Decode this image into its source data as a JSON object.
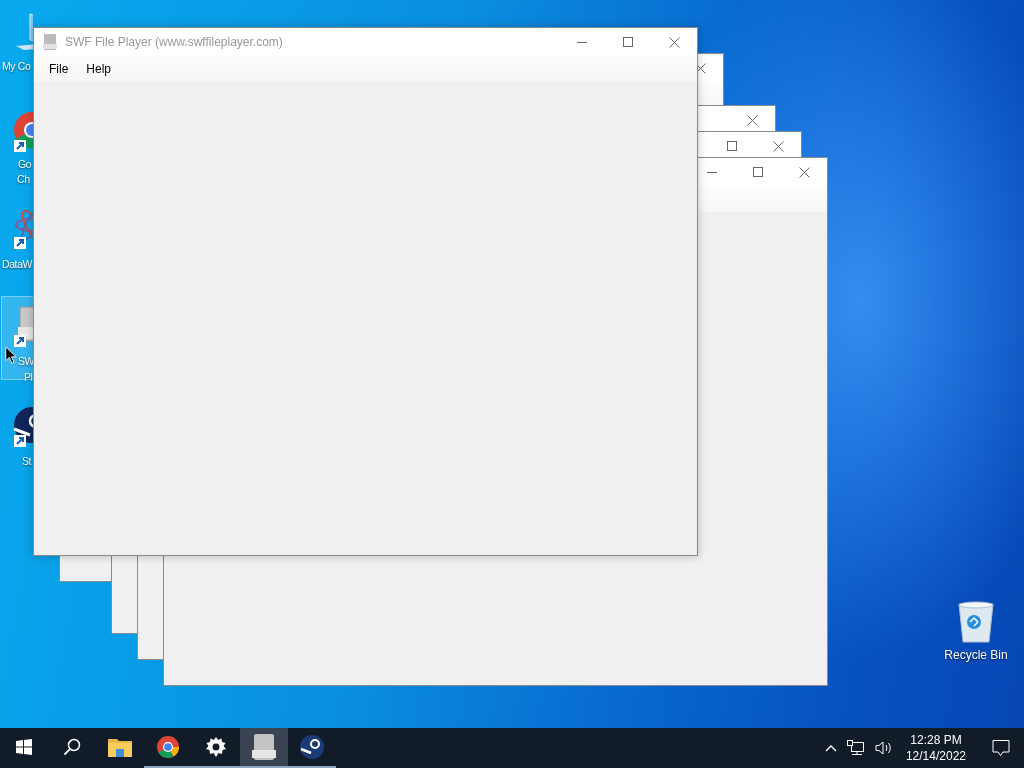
{
  "desktop_icons": [
    {
      "kind": "computer",
      "lines": [
        "My Co"
      ],
      "selected": false
    },
    {
      "kind": "chrome",
      "lines": [
        "Go",
        "Ch"
      ],
      "selected": false
    },
    {
      "kind": "atom",
      "lines": [
        "DataW"
      ],
      "selected": false
    },
    {
      "kind": "swf",
      "lines": [
        "SW",
        "Pl"
      ],
      "selected": true
    },
    {
      "kind": "steam",
      "lines": [
        "St"
      ],
      "selected": false
    }
  ],
  "windows": [
    {
      "title": "SWF File Player (www.swffileplayer.com)",
      "menu": [
        "File",
        "Help"
      ],
      "controls": [
        {
          "kind": "minimize"
        },
        {
          "kind": "maximize"
        },
        {
          "kind": "close"
        }
      ]
    },
    {
      "controls": [
        {
          "kind": "close"
        }
      ]
    },
    {
      "controls": [
        {
          "kind": "close"
        }
      ]
    },
    {
      "controls": [
        {
          "kind": "maximize"
        },
        {
          "kind": "close"
        }
      ]
    },
    {
      "controls": [
        {
          "kind": "minimize"
        },
        {
          "kind": "maximize"
        },
        {
          "kind": "close"
        }
      ]
    }
  ],
  "recycle_bin": {
    "label": "Recycle Bin"
  },
  "taskbar": {
    "buttons": [
      {
        "kind": "start",
        "running": false,
        "selected": false
      },
      {
        "kind": "search",
        "running": false,
        "selected": false
      },
      {
        "kind": "explorer",
        "running": false,
        "selected": false
      },
      {
        "kind": "chrome",
        "running": true,
        "selected": false
      },
      {
        "kind": "settings",
        "running": true,
        "selected": false
      },
      {
        "kind": "swf",
        "running": true,
        "selected": true
      },
      {
        "kind": "steam",
        "running": true,
        "selected": false
      }
    ],
    "tray": {
      "time": "12:28 PM",
      "date": "12/14/2022"
    }
  }
}
